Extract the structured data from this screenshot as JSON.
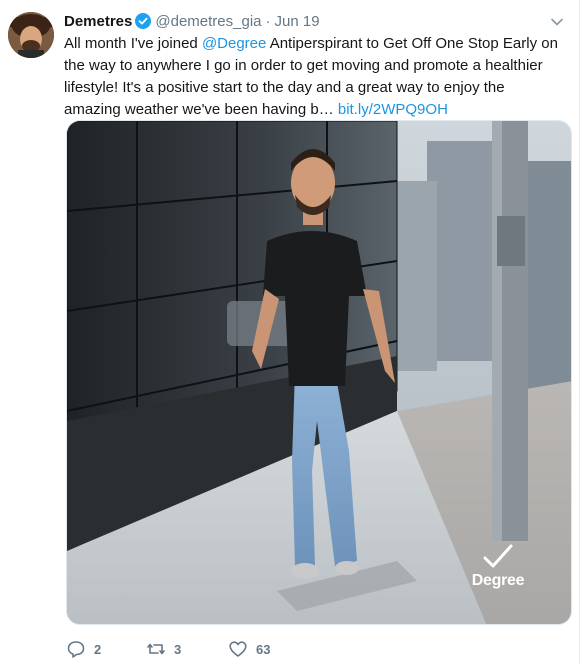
{
  "tweet": {
    "author_name": "Demetres",
    "author_handle": "@demetres_gia",
    "separator": "·",
    "date": "Jun 19",
    "text_part1": "All month I've joined ",
    "mention": "@Degree",
    "text_part2": " Antiperspirant to Get Off One Stop Early on the way to anywhere I go in order to get moving and promote a healthier lifestyle! It's a positive start to the day and a great way to enjoy the amazing weather we've been having b… ",
    "url": "bit.ly/2WPQ9OH",
    "brand_logo_text": "Degree",
    "actions": {
      "reply_count": "2",
      "retweet_count": "3",
      "like_count": "63"
    }
  },
  "colors": {
    "link": "#1b95e0",
    "muted": "#657786",
    "verified": "#1da1f2"
  },
  "icons": [
    "verified-badge-icon",
    "chevron-down-icon",
    "reply-icon",
    "retweet-icon",
    "like-icon",
    "degree-check-icon"
  ]
}
